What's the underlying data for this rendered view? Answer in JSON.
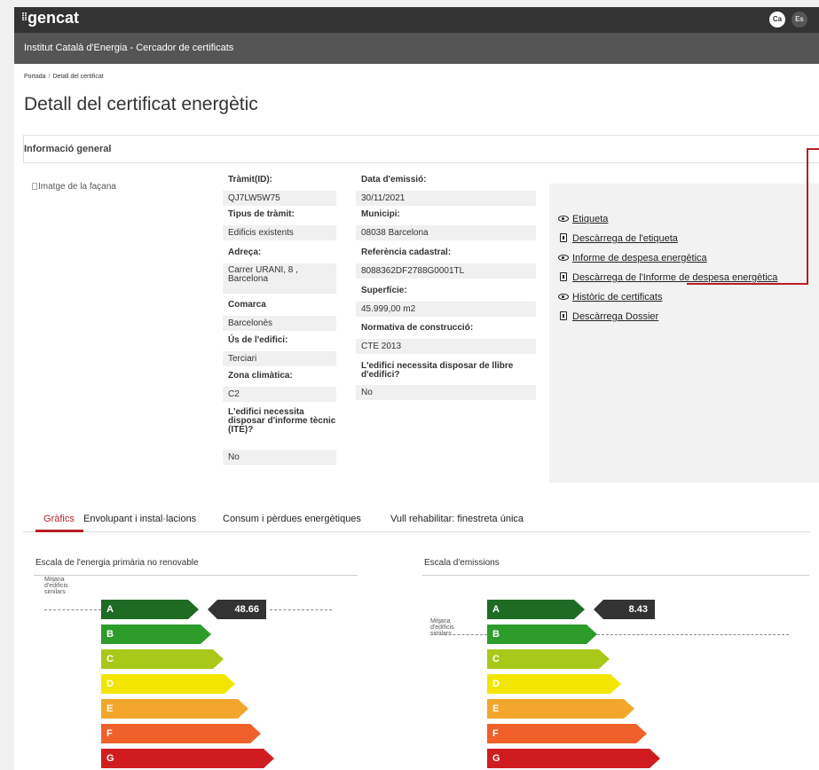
{
  "brand": {
    "name": "gencat",
    "dots": "⁞⁞"
  },
  "languages": {
    "ca": "Ca",
    "es": "Es"
  },
  "subheader": {
    "title": "Institut Català d'Energia - Cercador de certificats"
  },
  "breadcrumb": {
    "home": "Portada",
    "separator": "/",
    "current": "Detall del certificat"
  },
  "page_title": "Detall del certificat energètic",
  "section_title": "Informació general",
  "facade_image_alt": "Imatge de la façana",
  "fields_col1": [
    {
      "label": "Tràmit(ID):",
      "value": "QJ7LW5W75"
    },
    {
      "label": "Tipus de tràmit:",
      "value": "Edificis existents"
    },
    {
      "label": "Adreça:",
      "value": "Carrer URANI, 8 , Barcelona"
    },
    {
      "label": "Comarca",
      "value": "Barcelonès"
    },
    {
      "label": "Ús de l'edifici:",
      "value": "Terciari"
    },
    {
      "label": "Zona climàtica:",
      "value": "C2"
    },
    {
      "label": "L'edifici necessita disposar d'informe tècnic (ITE)?",
      "value": "No"
    }
  ],
  "fields_col2": [
    {
      "label": "Data d'emissió:",
      "value": "30/11/2021"
    },
    {
      "label": "Municipi:",
      "value": "08038 Barcelona"
    },
    {
      "label": "Referència cadastral:",
      "value": "8088362DF2788G0001TL"
    },
    {
      "label": "Superfície:",
      "value": "45.999,00 m2"
    },
    {
      "label": "Normativa de construcció:",
      "value": "CTE 2013"
    },
    {
      "label": "L'edifici necessita disposar de llibre d'edifici?",
      "value": "No"
    }
  ],
  "links": [
    {
      "label": "Etiqueta",
      "icon": "eye-icon"
    },
    {
      "label": "Descàrrega de l'etiqueta",
      "icon": "download-file-icon"
    },
    {
      "label": "Informe de despesa energètica",
      "icon": "eye-icon"
    },
    {
      "label": "Descàrrega de l'Informe de despesa energètica",
      "icon": "download-file-icon"
    },
    {
      "label": "Històric de certificats",
      "icon": "eye-icon"
    },
    {
      "label": "Descàrrega Dossier",
      "icon": "download-file-icon"
    }
  ],
  "highlight_color": "#b81d25",
  "tabs": [
    "Gràfics",
    "Envolupant i instal·lacions",
    "Consum i pèrdues energètiques",
    "Vull rehabilitar: finestreta única"
  ],
  "active_tab": "Gràfics",
  "avg_label": [
    "Mitjana",
    "d'edificis",
    "similars"
  ],
  "chart_data": [
    {
      "type": "bar",
      "title": "Escala de l'energia primària no renovable",
      "categories": [
        "A",
        "B",
        "C",
        "D",
        "E",
        "F",
        "G"
      ],
      "colors": [
        "#1e6b24",
        "#2e9c2b",
        "#a8c918",
        "#f2e600",
        "#f2a62b",
        "#f0602b",
        "#d01c1f"
      ],
      "rating": "A",
      "value": "48.66",
      "average_rating": "A"
    },
    {
      "type": "bar",
      "title": "Escala d'emissions",
      "categories": [
        "A",
        "B",
        "C",
        "D",
        "E",
        "F",
        "G"
      ],
      "colors": [
        "#1e6b24",
        "#2e9c2b",
        "#a8c918",
        "#f2e600",
        "#f2a62b",
        "#f0602b",
        "#d01c1f"
      ],
      "rating": "A",
      "value": "8.43",
      "average_rating": "B"
    }
  ]
}
